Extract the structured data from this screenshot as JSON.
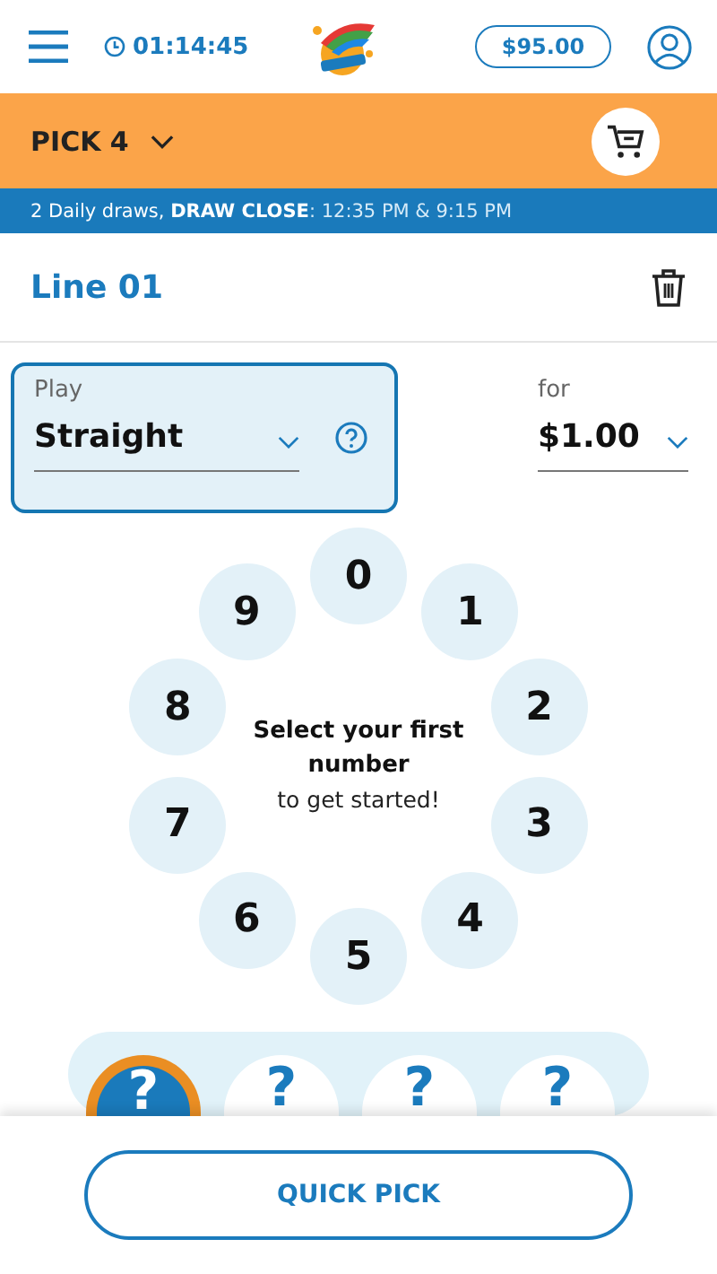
{
  "header": {
    "timer": "01:14:45",
    "balance": "$95.00"
  },
  "game": {
    "name": "PICK 4"
  },
  "info": {
    "draws": "2 Daily draws,",
    "close_label": "DRAW CLOSE",
    "close_times": ": 12:35 PM & 9:15 PM"
  },
  "line": {
    "title": "Line 01"
  },
  "play": {
    "label": "Play",
    "value": "Straight",
    "focused": true
  },
  "amount": {
    "label": "for",
    "value": "$1.00"
  },
  "numbers": [
    "0",
    "1",
    "2",
    "3",
    "4",
    "5",
    "6",
    "7",
    "8",
    "9"
  ],
  "prompt": {
    "title": "Select your first number",
    "subtitle": "to get started!"
  },
  "slots": [
    {
      "text": "?",
      "selected": true
    },
    {
      "text": "?",
      "selected": false
    },
    {
      "text": "?",
      "selected": false
    },
    {
      "text": "?",
      "selected": false
    }
  ],
  "quick_pick": "QUICK PICK"
}
